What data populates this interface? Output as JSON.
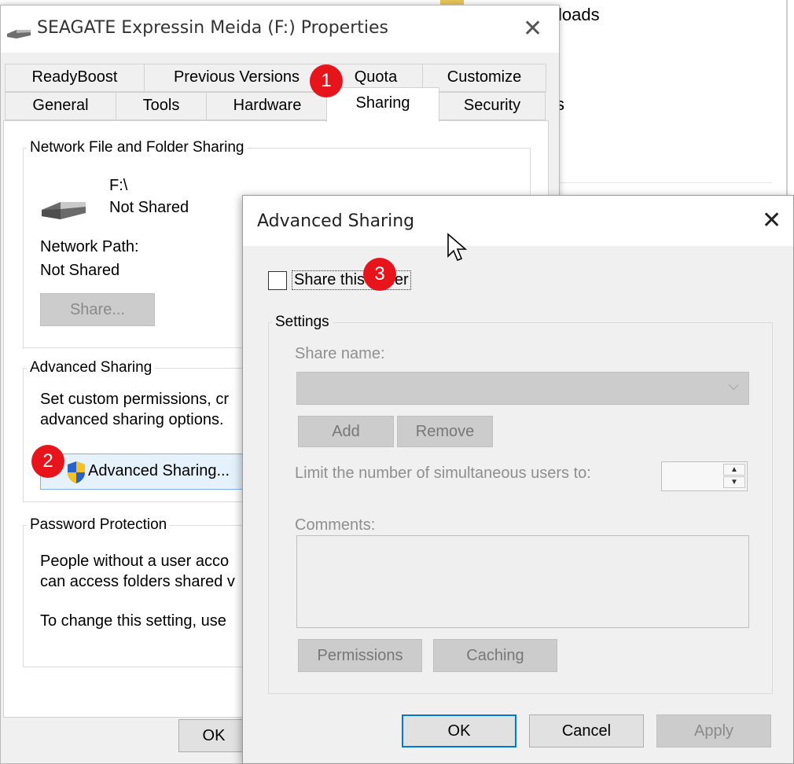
{
  "background": {
    "line1": "loads",
    "line2": "s"
  },
  "properties": {
    "title": "SEAGATE Expressin Meida (F:) Properties",
    "tabs_row1": [
      "ReadyBoost",
      "Previous Versions",
      "Quota",
      "Customize"
    ],
    "tabs_row2": [
      "General",
      "Tools",
      "Hardware",
      "Sharing",
      "Security"
    ],
    "active_tab": "Sharing",
    "network_section": {
      "legend": "Network File and Folder Sharing",
      "drive": "F:\\",
      "status": "Not Shared",
      "path_label": "Network Path:",
      "path_value": "Not Shared",
      "share_button": "Share..."
    },
    "advanced_section": {
      "legend": "Advanced Sharing",
      "desc_line1": "Set custom permissions, cr",
      "desc_line2": "advanced sharing options.",
      "button": "Advanced Sharing..."
    },
    "password_section": {
      "legend": "Password Protection",
      "line1": "People without a user acco",
      "line2": "can access folders shared v",
      "line3": "To change this setting, use"
    },
    "ok_button": "OK"
  },
  "advanced_dialog": {
    "title": "Advanced Sharing",
    "share_checkbox_label": "Share this folder",
    "share_checkbox_checked": false,
    "settings_legend": "Settings",
    "share_name_label": "Share name:",
    "add_button": "Add",
    "remove_button": "Remove",
    "limit_label": "Limit the number of simultaneous users to:",
    "comments_label": "Comments:",
    "permissions_button": "Permissions",
    "caching_button": "Caching",
    "ok_button": "OK",
    "cancel_button": "Cancel",
    "apply_button": "Apply"
  },
  "badges": [
    "1",
    "2",
    "3"
  ],
  "colors": {
    "badge": "#e8141b",
    "focus": "#0078d7",
    "hover_button": "#e5f1fb"
  }
}
